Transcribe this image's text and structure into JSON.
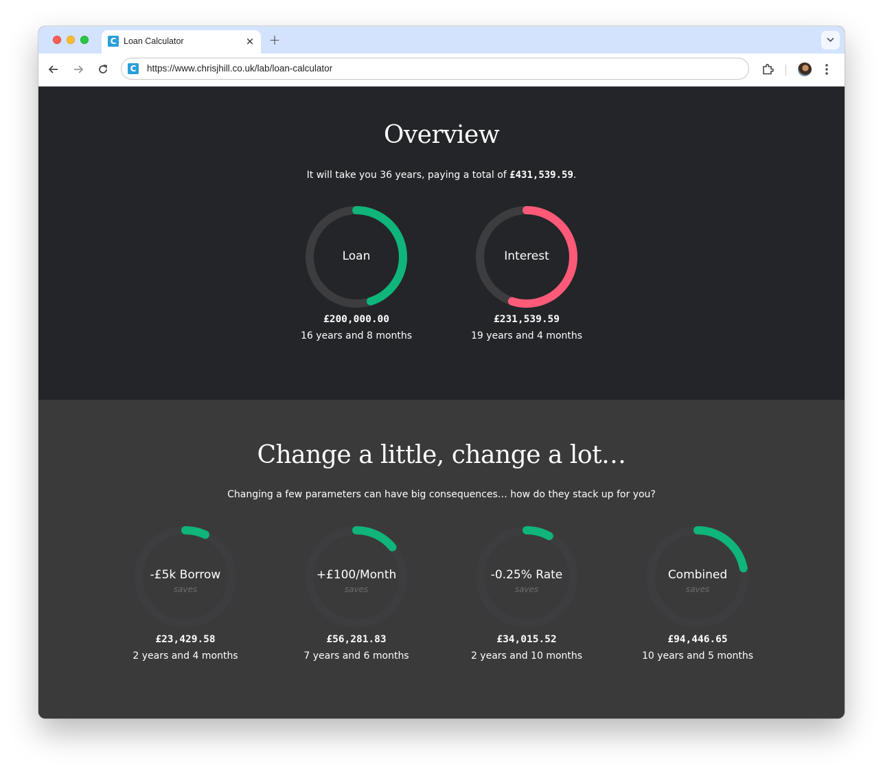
{
  "browser": {
    "tab_title": "Loan Calculator",
    "tab_favicon_letter": "C",
    "tab_close": "×",
    "new_tab": "+",
    "url": "https://www.chrisjhill.co.uk/lab/loan-calculator",
    "accent": "#d3e3fd"
  },
  "overview": {
    "title": "Overview",
    "summary_prefix": "It will take you 36 years, paying a total of ",
    "summary_total": "£431,539.59",
    "summary_suffix": ".",
    "rings": [
      {
        "label": "Loan",
        "amount": "£200,000.00",
        "time": "16 years and 8 months",
        "fraction": 0.45,
        "color": "#0fb57a"
      },
      {
        "label": "Interest",
        "amount": "£231,539.59",
        "time": "19 years and 4 months",
        "fraction": 0.55,
        "color": "#ff5a78"
      }
    ]
  },
  "change": {
    "title": "Change a little, change a lot…",
    "subtitle": "Changing a few parameters can have big consequences… how do they stack up for you?",
    "rings": [
      {
        "label": "-£5k Borrow",
        "sub": "saves",
        "amount": "£23,429.58",
        "time": "2 years and 4 months",
        "fraction": 0.07,
        "color": "#0fb57a"
      },
      {
        "label": "+£100/Month",
        "sub": "saves",
        "amount": "£56,281.83",
        "time": "7 years and 6 months",
        "fraction": 0.14,
        "color": "#0fb57a"
      },
      {
        "label": "-0.25% Rate",
        "sub": "saves",
        "amount": "£34,015.52",
        "time": "2 years and 10 months",
        "fraction": 0.08,
        "color": "#0fb57a"
      },
      {
        "label": "Combined",
        "sub": "saves",
        "amount": "£94,446.65",
        "time": "10 years and 5 months",
        "fraction": 0.22,
        "color": "#0fb57a"
      }
    ]
  }
}
